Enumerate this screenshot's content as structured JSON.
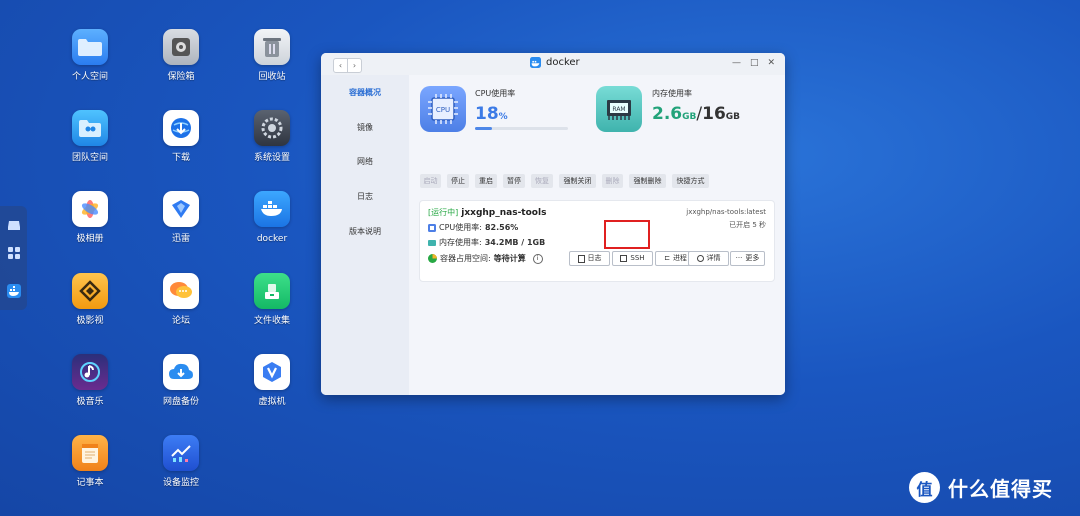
{
  "desktop": {
    "icons": [
      {
        "label": "个人空间",
        "icon": "folder-icon"
      },
      {
        "label": "保险箱",
        "icon": "safe-icon"
      },
      {
        "label": "回收站",
        "icon": "trash-icon"
      },
      {
        "label": "团队空间",
        "icon": "team-folder-icon"
      },
      {
        "label": "下载",
        "icon": "download-globe-icon"
      },
      {
        "label": "系统设置",
        "icon": "settings-icon"
      },
      {
        "label": "极相册",
        "icon": "photos-icon"
      },
      {
        "label": "迅雷",
        "icon": "thunder-icon"
      },
      {
        "label": "docker",
        "icon": "docker-icon"
      },
      {
        "label": "极影视",
        "icon": "video-icon"
      },
      {
        "label": "论坛",
        "icon": "forum-icon"
      },
      {
        "label": "文件收集",
        "icon": "file-collect-icon"
      },
      {
        "label": "极音乐",
        "icon": "music-icon"
      },
      {
        "label": "网盘备份",
        "icon": "cloud-backup-icon"
      },
      {
        "label": "虚拟机",
        "icon": "vm-icon"
      },
      {
        "label": "记事本",
        "icon": "notepad-icon"
      },
      {
        "label": "设备监控",
        "icon": "monitor-icon"
      }
    ]
  },
  "window": {
    "title": "docker",
    "nav_back": "‹",
    "nav_forward": "›",
    "controls": [
      "—",
      "□",
      "✕"
    ]
  },
  "sidebar": {
    "items": [
      "容器概况",
      "镜像",
      "网络",
      "日志",
      "版本说明"
    ],
    "active_index": 0
  },
  "stats": {
    "cpu": {
      "label": "CPU使用率",
      "value": "18",
      "unit": "%",
      "fraction": 0.18,
      "chip_text": "CPU"
    },
    "memory": {
      "label": "内存使用率",
      "used": "2.6",
      "used_unit": "GB",
      "sep": "/",
      "total": "16",
      "total_unit": "GB",
      "chip_text": "RAM"
    }
  },
  "toolbar": {
    "buttons": [
      {
        "label": "启动",
        "enabled": false
      },
      {
        "label": "停止",
        "enabled": true
      },
      {
        "label": "重启",
        "enabled": true
      },
      {
        "label": "暂停",
        "enabled": true
      },
      {
        "label": "恢复",
        "enabled": false
      },
      {
        "label": "强制关闭",
        "enabled": true
      },
      {
        "label": "删除",
        "enabled": false
      },
      {
        "label": "强制删除",
        "enabled": true
      },
      {
        "label": "快捷方式",
        "enabled": true
      }
    ]
  },
  "container": {
    "status": "[运行中]",
    "name": "jxxghp_nas-tools",
    "image": "jxxghp/nas-tools:latest",
    "uptime": "已开启 5 秒",
    "cpu_label": "CPU使用率:",
    "cpu_value": "82.56%",
    "mem_label": "内存使用率:",
    "mem_value": "34.2MB / 1GB",
    "disk_label": "容器占用空间:",
    "disk_value": "等待计算",
    "info_glyph": "i",
    "actions": [
      "日志",
      "SSH",
      "进程",
      "详情",
      "更多"
    ]
  },
  "watermark": {
    "text": "什么值得买",
    "glyph": "值"
  },
  "colors": {
    "accent": "#2c6fd4",
    "running": "#27a844",
    "highlight": "#e02020",
    "cpu_tile": "#5b8ff0",
    "ram_tile": "#4cc3c0"
  }
}
